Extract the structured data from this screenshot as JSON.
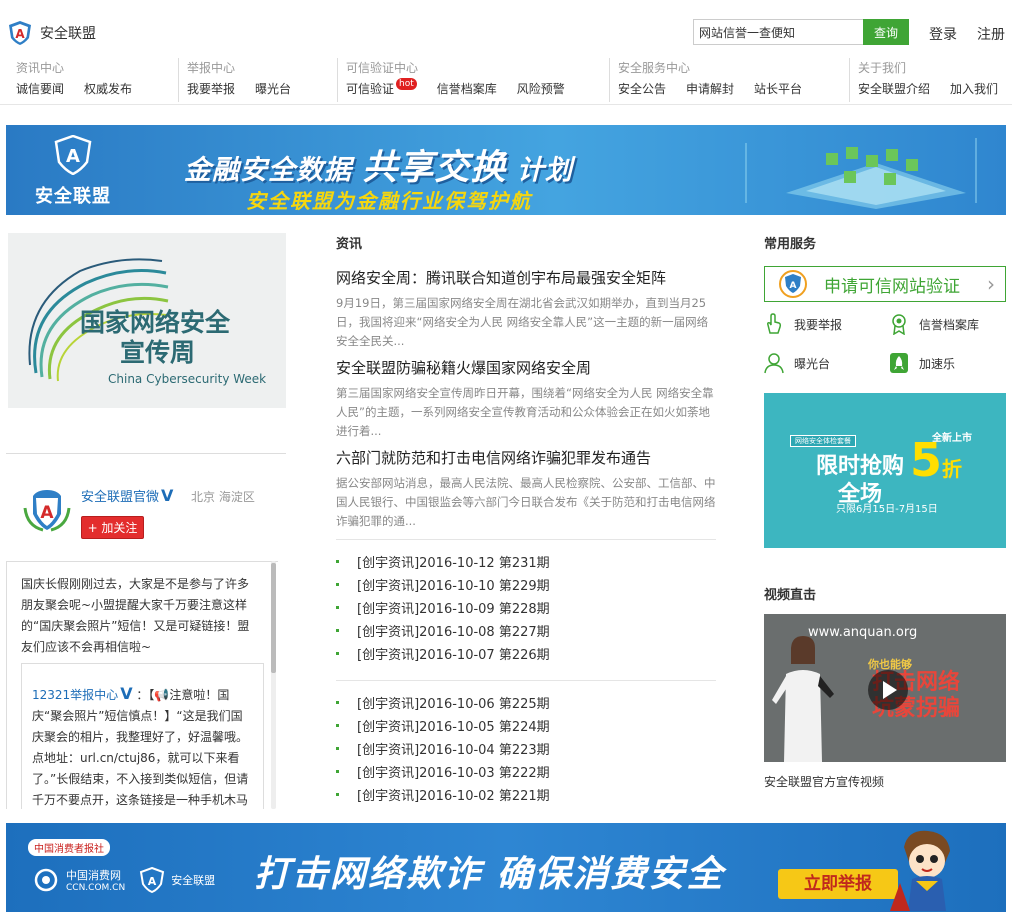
{
  "header": {
    "site_name": "安全联盟",
    "search_value": "网站信誉一查便知",
    "search_button": "查询",
    "login": "登录",
    "register": "注册"
  },
  "nav": [
    {
      "title": "资讯中心",
      "items": [
        {
          "label": "诚信要闻"
        },
        {
          "label": "权威发布"
        }
      ]
    },
    {
      "title": "举报中心",
      "items": [
        {
          "label": "我要举报"
        },
        {
          "label": "曝光台"
        }
      ]
    },
    {
      "title": "可信验证中心",
      "items": [
        {
          "label": "可信验证",
          "badge": "hot"
        },
        {
          "label": "信誉档案库"
        },
        {
          "label": "风险预警"
        }
      ]
    },
    {
      "title": "安全服务中心",
      "items": [
        {
          "label": "安全公告"
        },
        {
          "label": "申请解封"
        },
        {
          "label": "站长平台"
        }
      ]
    },
    {
      "title": "关于我们",
      "items": [
        {
          "label": "安全联盟介绍"
        },
        {
          "label": "加入我们"
        }
      ]
    }
  ],
  "banner": {
    "logo_text": "安全联盟",
    "title_pre": "金融安全数据",
    "title_big": "共享交换",
    "title_post": "计划",
    "subtitle": "安全联盟为金融行业保驾护航"
  },
  "cyber_week": {
    "title_line1": "国家网络安全",
    "title_line2": "宣传周",
    "english": "China Cybersecurity Week"
  },
  "weibo": {
    "name": "安全联盟官微",
    "verified": "V",
    "location": "北京 海淀区",
    "follow": "+ 加关注",
    "post": "国庆长假刚刚过去，大家是不是参与了许多朋友聚会呢~小盟提醒大家千万要注意这样的“国庆聚会照片”短信！又是可疑链接！盟友们应该不会再相信啦~",
    "repost_author": "12321举报中心",
    "repost_text": "：【📢注意啦！国庆“聚会照片”短信慎点！】“这是我们国庆聚会的相片，我整理好了，好温馨哦。点地址：url.cn/ctuj86，就可以下来看了。”长假结束，不入接到类似短信，但请千万不要点开，这条链接是一种手机木马"
  },
  "news": {
    "section_title": "资讯",
    "articles": [
      {
        "title": "网络安全周：腾讯联合知道创宇布局最强安全矩阵",
        "desc": "9月19日，第三届国家网络安全周在湖北省会武汉如期举办，直到当月25日，我国将迎来“网络安全为人民 网络安全靠人民”这一主题的新一届网络安全全民关..."
      },
      {
        "title": "安全联盟防骗秘籍火爆国家网络安全周",
        "desc": "第三届国家网络安全宣传周昨日开幕，围绕着“网络安全为人民 网络安全靠人民”的主题，一系列网络安全宣传教育活动和公众体验会正在如火如荼地进行着..."
      },
      {
        "title": "六部门就防范和打击电信网络诈骗犯罪发布通告",
        "desc": "据公安部网站消息，最高人民法院、最高人民检察院、公安部、工信部、中国人民银行、中国银监会等六部门今日联合发布《关于防范和打击电信网络诈骗犯罪的通..."
      }
    ],
    "list1": [
      "[创宇资讯]2016-10-12 第231期",
      "[创宇资讯]2016-10-10 第229期",
      "[创宇资讯]2016-10-09 第228期",
      "[创宇资讯]2016-10-08 第227期",
      "[创宇资讯]2016-10-07 第226期"
    ],
    "list2": [
      "[创宇资讯]2016-10-06 第225期",
      "[创宇资讯]2016-10-05 第224期",
      "[创宇资讯]2016-10-04 第223期",
      "[创宇资讯]2016-10-03 第222期",
      "[创宇资讯]2016-10-02 第221期"
    ]
  },
  "services": {
    "section_title": "常用服务",
    "verify": "申请可信网站验证",
    "items": [
      {
        "label": "我要举报",
        "icon": "hand-icon"
      },
      {
        "label": "信誉档案库",
        "icon": "award-icon"
      },
      {
        "label": "曝光台",
        "icon": "person-icon"
      },
      {
        "label": "加速乐",
        "icon": "rocket-icon"
      }
    ]
  },
  "promo": {
    "badge": "网络安全体检套餐",
    "new": "全新上市",
    "line1": "限时抢购",
    "line2": "全场",
    "five": "5",
    "fold": "折",
    "dates": "只限6月15日-7月15日"
  },
  "video": {
    "section_title": "视频直击",
    "url": "www.anquan.org",
    "cap1": "你也能够",
    "cap2_line1": "打击网络",
    "cap2_line2": "坑蒙拐骗",
    "caption": "安全联盟官方宣传视频"
  },
  "bottom_banner": {
    "ccn": "中国消费者报社",
    "ccn_site": "中国消费网",
    "ccn_domain": "CCN.COM.CN",
    "alliance": "安全联盟",
    "slogan": "打击网络欺诈  确保消费安全",
    "report": "立即举报"
  }
}
